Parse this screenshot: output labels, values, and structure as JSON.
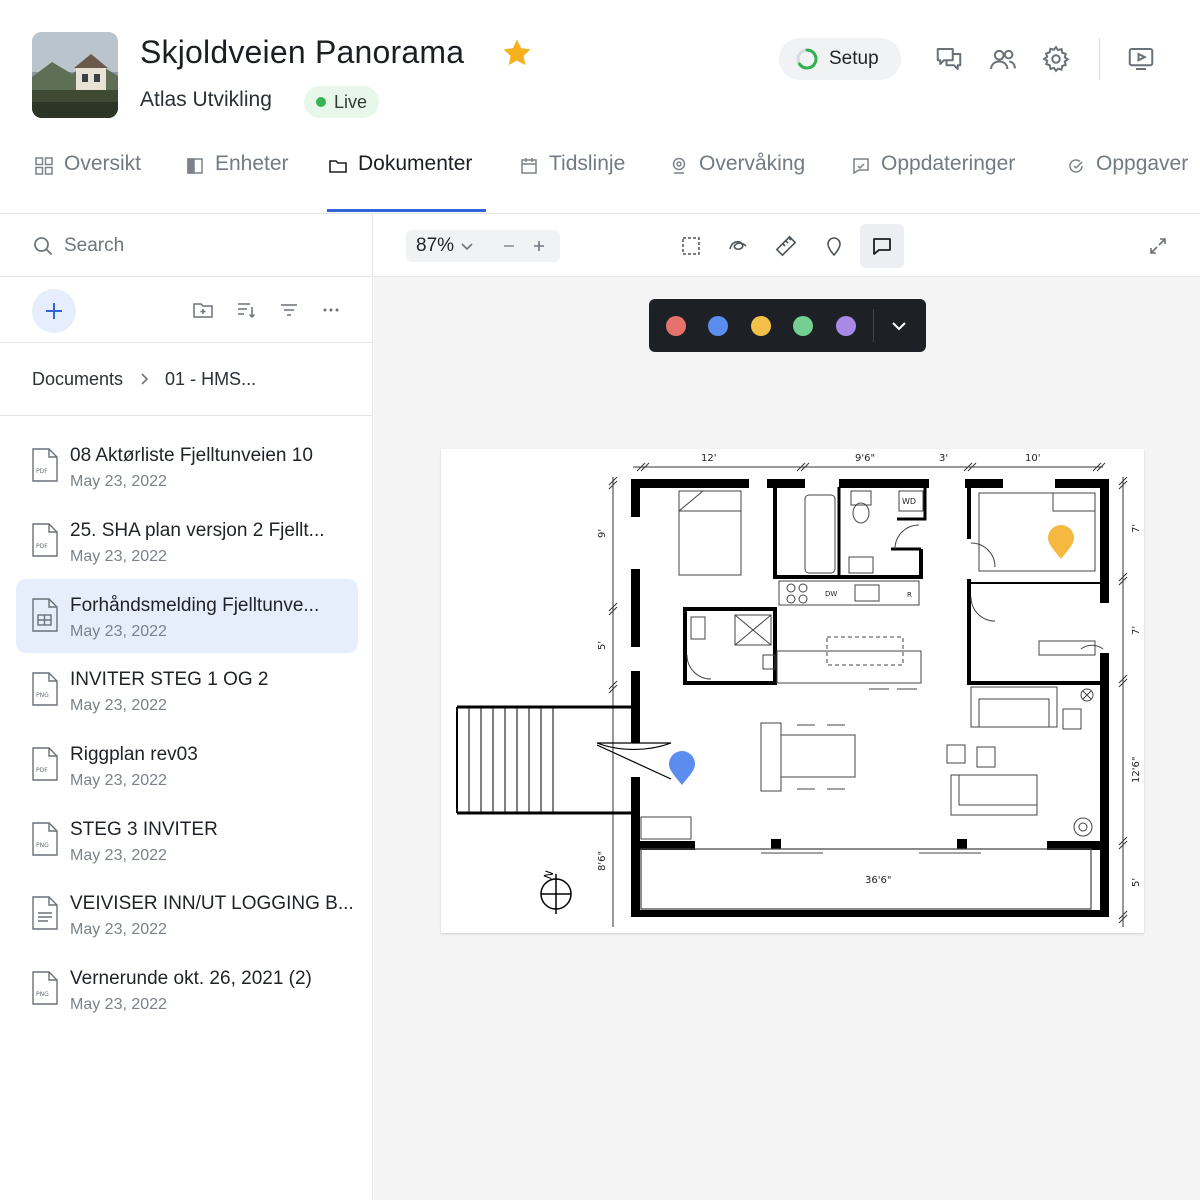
{
  "project": {
    "title": "Skjoldveien Panorama",
    "company": "Atlas Utvikling",
    "status": "Live",
    "favorite": true
  },
  "header": {
    "setup_label": "Setup",
    "icons": [
      "comments-icon",
      "users-icon",
      "settings-icon",
      "presentation-icon"
    ]
  },
  "tabs": [
    {
      "label": "Oversikt",
      "icon": "grid-icon",
      "active": false
    },
    {
      "label": "Enheter",
      "icon": "units-icon",
      "active": false
    },
    {
      "label": "Dokumenter",
      "icon": "folder-icon",
      "active": true
    },
    {
      "label": "Tidslinje",
      "icon": "calendar-icon",
      "active": false
    },
    {
      "label": "Overvåking",
      "icon": "camera-icon",
      "active": false
    },
    {
      "label": "Oppdateringer",
      "icon": "updates-icon",
      "active": false
    },
    {
      "label": "Oppgaver",
      "icon": "tasks-icon",
      "active": false
    }
  ],
  "sidebar": {
    "search_placeholder": "Search",
    "breadcrumb": [
      "Documents",
      "01 - HMS..."
    ],
    "files": [
      {
        "name": "08 Aktørliste Fjelltunveien 10",
        "date": "May 23, 2022",
        "type": "PDF",
        "selected": false
      },
      {
        "name": "25. SHA plan versjon 2 Fjellt...",
        "date": "May 23, 2022",
        "type": "PDF",
        "selected": false
      },
      {
        "name": "Forhåndsmelding Fjelltunve...",
        "date": "May 23, 2022",
        "type": "SHEET",
        "selected": true
      },
      {
        "name": "INVITER STEG 1 OG 2",
        "date": "May 23, 2022",
        "type": "PNG",
        "selected": false
      },
      {
        "name": "Riggplan rev03",
        "date": "May 23, 2022",
        "type": "PDF",
        "selected": false
      },
      {
        "name": "STEG 3 INVITER",
        "date": "May 23, 2022",
        "type": "PNG",
        "selected": false
      },
      {
        "name": "VEIVISER INN/UT LOGGING B...",
        "date": "May 23, 2022",
        "type": "DOC",
        "selected": false
      },
      {
        "name": "Vernerunde okt. 26, 2021 (2)",
        "date": "May 23, 2022",
        "type": "PNG",
        "selected": false
      }
    ]
  },
  "viewer": {
    "zoom": "87%",
    "tools": [
      "select-area-icon",
      "draw-icon",
      "measure-icon",
      "pin-icon",
      "comment-icon"
    ],
    "active_tool": "comment-icon",
    "palette_colors": [
      "#e5736c",
      "#5b8def",
      "#f5c04a",
      "#74cf93",
      "#a88ae6"
    ]
  },
  "floorplan": {
    "dimensions": {
      "top": [
        "12'",
        "9'6\"",
        "3'",
        "10'"
      ],
      "left": [
        "9'",
        "5'",
        "8'6\""
      ],
      "right": [
        "7'",
        "7'",
        "12'6\"",
        "5'"
      ],
      "bottom": "36'6\""
    },
    "labels": {
      "washer_dryer": "WD",
      "dishwasher": "DW",
      "refrigerator": "R",
      "north": "N"
    },
    "pins": [
      {
        "color": "#f5b942",
        "room": "bedroom-right"
      },
      {
        "color": "#5b8def",
        "room": "entrance"
      }
    ]
  }
}
